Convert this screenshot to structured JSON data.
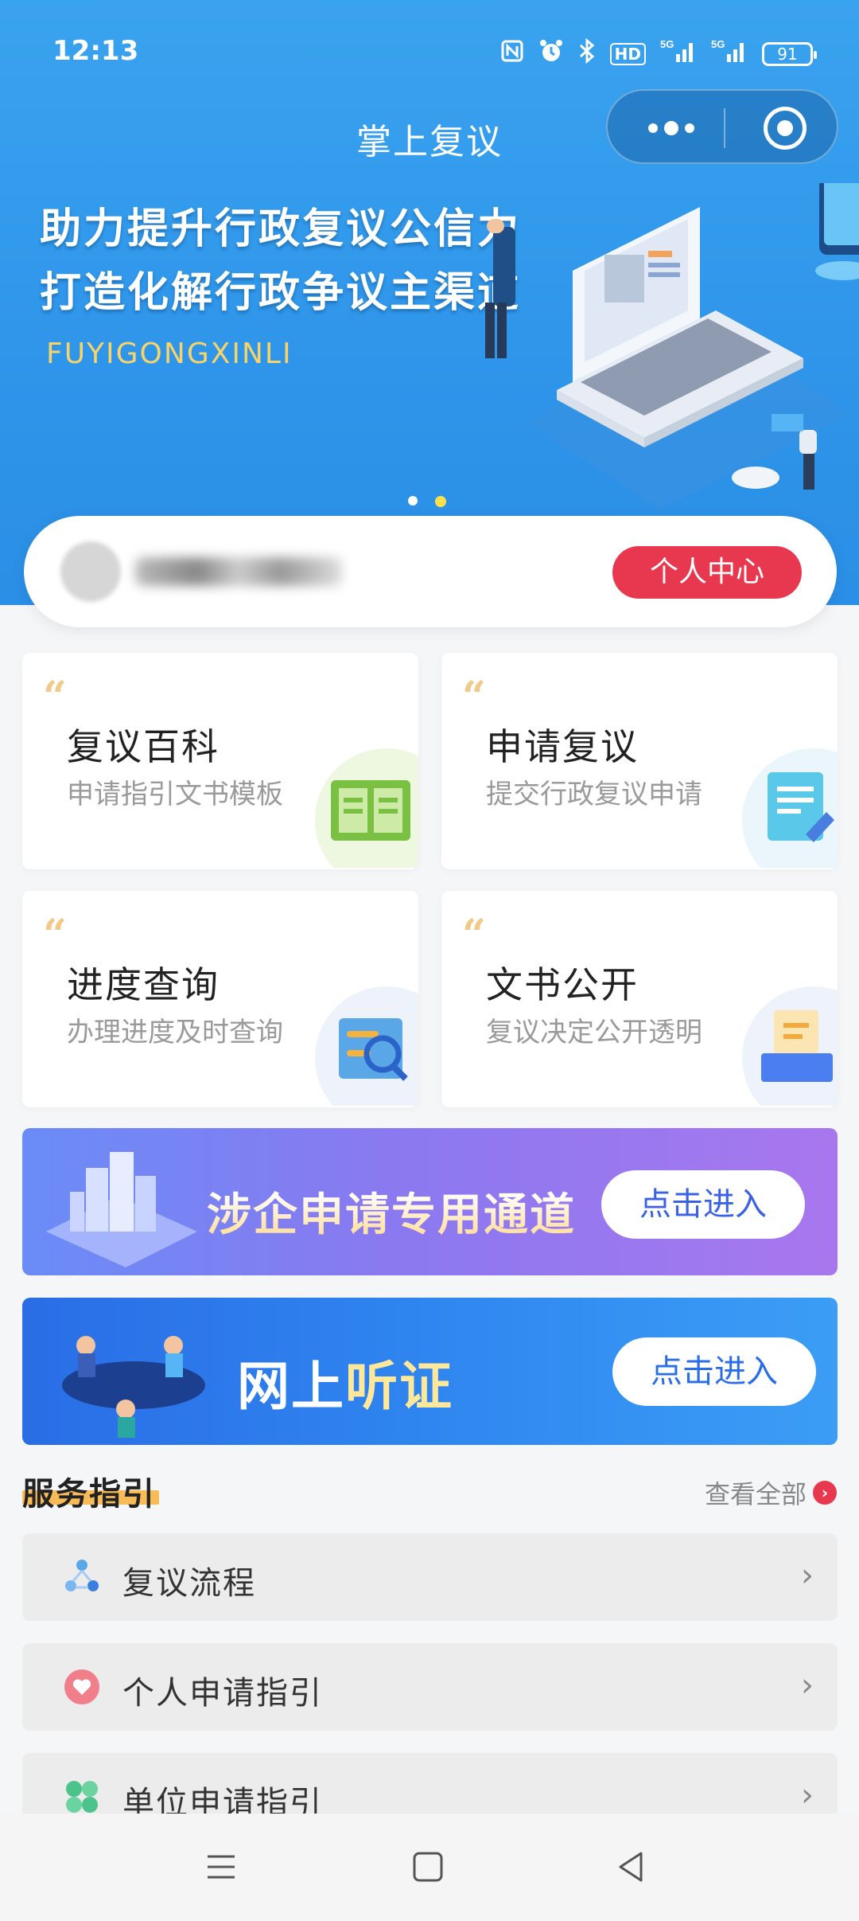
{
  "status_bar": {
    "time": "12:13",
    "icons": [
      "nfc-icon",
      "alarm-icon",
      "bluetooth-icon",
      "hd-icon",
      "signal-5g-icon",
      "signal-5g-icon"
    ],
    "hd_label": "HD",
    "network_label": "5G",
    "battery": "91"
  },
  "nav": {
    "title": "掌上复议"
  },
  "hero": {
    "slogan_line1": "助力提升行政复议公信力",
    "slogan_line2": "打造化解行政争议主渠道",
    "subtitle": "FUYIGONGXINLI",
    "slides_total": 2,
    "active_slide": 2
  },
  "user_card": {
    "personal_center_label": "个人中心"
  },
  "grid": [
    {
      "title": "复议百科",
      "subtitle": "申请指引文书模板",
      "icon": "book-icon"
    },
    {
      "title": "申请复议",
      "subtitle": "提交行政复议申请",
      "icon": "document-edit-icon"
    },
    {
      "title": "进度查询",
      "subtitle": "办理进度及时查询",
      "icon": "search-progress-icon"
    },
    {
      "title": "文书公开",
      "subtitle": "复议决定公开透明",
      "icon": "inbox-document-icon"
    }
  ],
  "banners": [
    {
      "text": "涉企申请专用通道",
      "button": "点击进入"
    },
    {
      "text_part1": "网上",
      "text_part2": "听证",
      "button": "点击进入"
    }
  ],
  "service_guide": {
    "title": "服务指引",
    "more_label": "查看全部",
    "items": [
      {
        "label": "复议流程",
        "icon": "process-cycle-icon"
      },
      {
        "label": "个人申请指引",
        "icon": "heart-icon"
      },
      {
        "label": "单位申请指引",
        "icon": "clover-icon"
      }
    ]
  },
  "colors": {
    "primary_blue": "#2f96ea",
    "accent_red": "#e8384f",
    "underline_orange": "#f7b23b"
  }
}
